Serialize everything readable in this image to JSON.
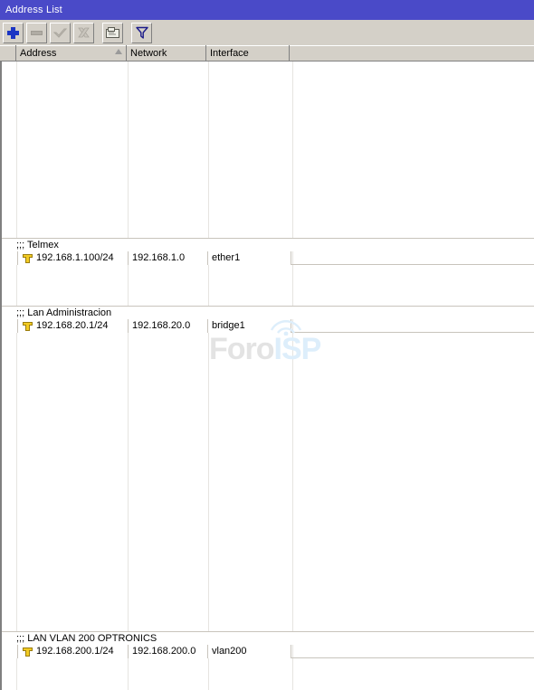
{
  "window": {
    "title": "Address List",
    "titlebar_color": "#4a4ac8",
    "toolbar_color": "#d4d0c8"
  },
  "toolbar": {
    "buttons": [
      {
        "name": "add-button",
        "icon": "plus-icon",
        "label": "Add",
        "enabled": true
      },
      {
        "name": "remove-button",
        "icon": "minus-icon",
        "label": "Remove",
        "enabled": false
      },
      {
        "name": "enable-button",
        "icon": "check-icon",
        "label": "Enable",
        "enabled": false
      },
      {
        "name": "disable-button",
        "icon": "cross-icon",
        "label": "Disable",
        "enabled": false
      },
      {
        "name": "comment-button",
        "icon": "comment-icon",
        "label": "Comment",
        "enabled": true
      },
      {
        "name": "filter-button",
        "icon": "filter-icon",
        "label": "Filter",
        "enabled": true
      }
    ]
  },
  "table": {
    "columns": [
      {
        "key": "flag",
        "label": ""
      },
      {
        "key": "address",
        "label": "Address",
        "sort": "ascending"
      },
      {
        "key": "network",
        "label": "Network"
      },
      {
        "key": "interface",
        "label": "Interface"
      }
    ],
    "groups": [
      {
        "comment": ";;; Telmex",
        "rows": [
          {
            "icon": "address-icon",
            "address": "192.168.1.100/24",
            "network": "192.168.1.0",
            "interface": "ether1"
          }
        ]
      },
      {
        "comment": ";;; Lan Administracion",
        "rows": [
          {
            "icon": "address-icon",
            "address": "192.168.20.1/24",
            "network": "192.168.20.0",
            "interface": "bridge1"
          }
        ]
      },
      {
        "comment": ";;; LAN VLAN 200 OPTRONICS",
        "rows": [
          {
            "icon": "address-icon",
            "address": "192.168.200.1/24",
            "network": "192.168.200.0",
            "interface": "vlan200"
          }
        ]
      }
    ]
  },
  "watermark": {
    "text_primary": "Foro",
    "text_secondary": "ISP",
    "color_primary": "#e3e3e3",
    "color_secondary": "#ddeefb"
  }
}
